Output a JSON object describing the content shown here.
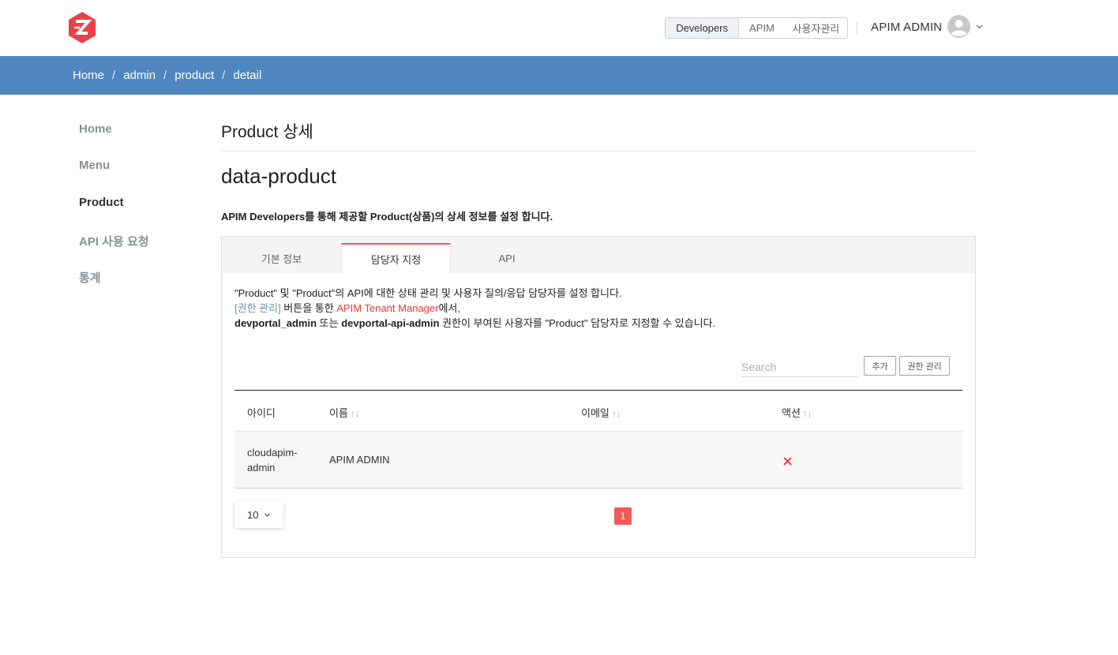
{
  "header": {
    "nav": [
      "Developers",
      "APIM",
      "사용자관리"
    ],
    "user_name": "APIM ADMIN",
    "brand_color": "#e8414a"
  },
  "breadcrumb": [
    "Home",
    "admin",
    "product",
    "detail"
  ],
  "sidebar": {
    "items": [
      {
        "label": "Home"
      },
      {
        "label": "Menu"
      },
      {
        "label": "Product"
      },
      {
        "label": "API 사용 요청"
      },
      {
        "label": "통계"
      }
    ]
  },
  "main": {
    "page_title": "Product 상세",
    "product_name": "data-product",
    "description": "APIM Developers를 통해 제공할 Product(상품)의 상세 정보를 설정 합니다.",
    "tabs": [
      {
        "label": "기본 정보"
      },
      {
        "label": "담당자 지정"
      },
      {
        "label": "API"
      }
    ],
    "info": {
      "line1": "\"Product\" 및 \"Product\"의 API에 대한 상태 관리 및 사용자 질의/응답 담당자를 설정 합니다.",
      "perm_link": "[권한 관리]",
      "line2_mid": " 버튼을 통한 ",
      "tenant_link": "APIM Tenant Manager",
      "line2_end": "에서,",
      "role1": "devportal_admin",
      "or_text": " 또는 ",
      "role2": "devportal-api-admin",
      "line3_end": " 권한이 부여된 사용자를 \"Product\" 담당자로 지정할 수 있습니다."
    },
    "search_placeholder": "Search",
    "add_button": "추가",
    "perm_button": "권한 관리",
    "table": {
      "columns": [
        "아이디",
        "이름",
        "이메일",
        "액션"
      ],
      "sort_glyph": "↑↓",
      "rows": [
        {
          "id_line1": "cloudapim-",
          "id_line2": "admin",
          "name": "APIM ADMIN",
          "email": ""
        }
      ]
    },
    "page_size": "10",
    "current_page": "1"
  }
}
